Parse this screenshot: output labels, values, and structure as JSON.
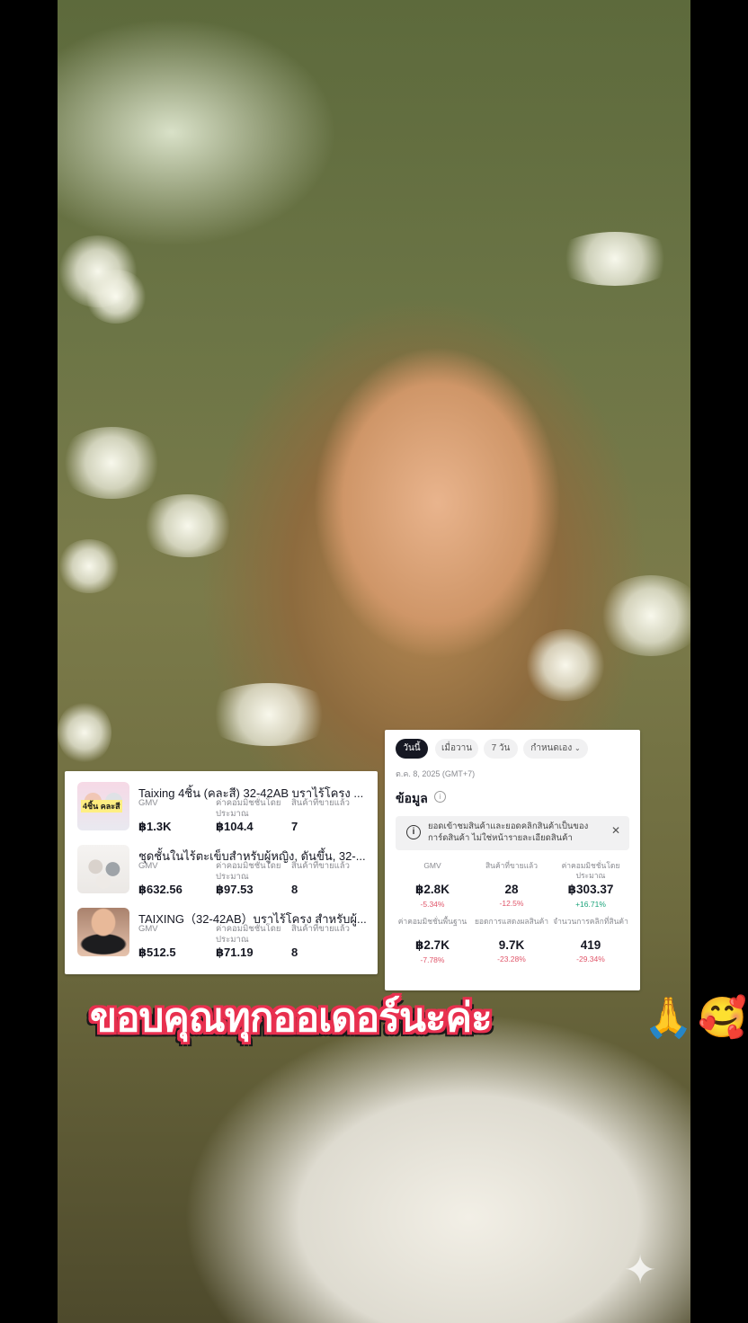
{
  "products": [
    {
      "name": "Taixing 4ชิ้น (คละสี) 32-42AB บราไร้โครง ...",
      "thumb_text": "4ชิ้น คละสี",
      "labels": [
        "GMV",
        "ค่าคอมมิชชั่นโดยประมาณ",
        "สินค้าที่ขายแล้ว"
      ],
      "gmv": "฿1.3K",
      "commission": "฿104.4",
      "sold": "7"
    },
    {
      "name": "ชุดชั้นในไร้ตะเข็บสำหรับผู้หญิง, ดันขึ้น, 32-...",
      "thumb_text": "",
      "labels": [
        "GMV",
        "ค่าคอมมิชชั่นโดยประมาณ",
        "สินค้าที่ขายแล้ว"
      ],
      "gmv": "฿632.56",
      "commission": "฿97.53",
      "sold": "8"
    },
    {
      "name": "TAIXING（32-42AB）บราไร้โครง สำหรับผู้...",
      "thumb_text": "",
      "labels": [
        "GMV",
        "ค่าคอมมิชชั่นโดยประมาณ",
        "สินค้าที่ขายแล้ว"
      ],
      "gmv": "฿512.5",
      "commission": "฿71.19",
      "sold": "8"
    }
  ],
  "analytics": {
    "tabs": [
      "วันนี้",
      "เมื่อวาน",
      "7 วัน",
      "กำหนดเอง"
    ],
    "date": "ต.ค. 8, 2025 (GMT+7)",
    "section_title": "ข้อมูล",
    "notice": "ยอดเข้าชมสินค้าและยอดคลิกสินค้าเป็นของการ์ดสินค้า ไม่ใช่หน้ารายละเอียดสินค้า",
    "metrics": [
      {
        "label": "GMV",
        "value": "฿2.8K",
        "change": "-5.34%"
      },
      {
        "label": "สินค้าที่ขายแล้ว",
        "value": "28",
        "change": "-12.5%"
      },
      {
        "label": "ค่าคอมมิชชั่นโดยประมาณ",
        "value": "฿303.37",
        "change": "+16.71%"
      },
      {
        "label": "ค่าคอมมิชชั่นพื้นฐาน",
        "value": "฿2.7K",
        "change": "-7.78%"
      },
      {
        "label": "ยอดการแสดงผลสินค้า",
        "value": "9.7K",
        "change": "-23.28%"
      },
      {
        "label": "จำนวนการคลิกที่สินค้า",
        "value": "419",
        "change": "-29.34%"
      }
    ]
  },
  "caption": "ขอบคุณทุกออเดอร์นะค่ะ",
  "emojis": [
    "🙏",
    "🥰"
  ],
  "colors": {
    "caption_outline": "#e8304f",
    "positive": "#1aa37a",
    "negative": "#e0566a",
    "tab_active": "#161823"
  }
}
